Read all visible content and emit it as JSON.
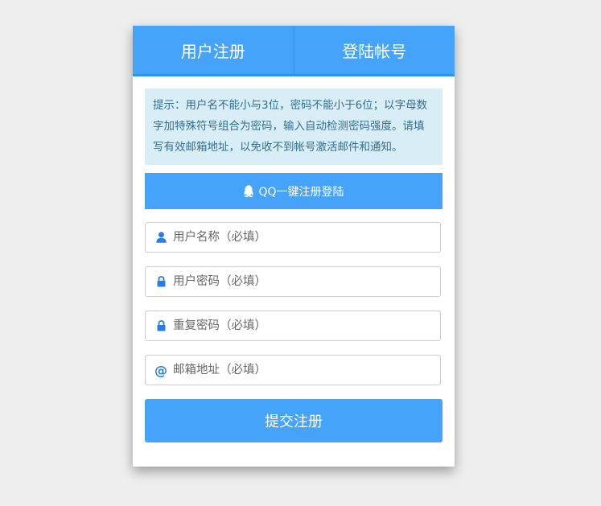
{
  "tabs": [
    {
      "label": "用户注册"
    },
    {
      "label": "登陆帐号"
    }
  ],
  "notice": {
    "text": "提示：用户名不能小与3位，密码不能小于6位；以字母数字加特殊符号组合为密码，输入自动检测密码强度。请填写有效邮箱地址，以免收不到帐号激活邮件和通知。"
  },
  "qq_button": {
    "label": "QQ一键注册登陆",
    "icon": "qq-icon"
  },
  "fields": [
    {
      "placeholder": "用户名称（必填）",
      "icon": "user-icon"
    },
    {
      "placeholder": "用户密码（必填）",
      "icon": "lock-icon"
    },
    {
      "placeholder": "重复密码（必填）",
      "icon": "lock-icon"
    },
    {
      "placeholder": "邮箱地址（必填）",
      "icon": "at-icon",
      "icon_glyph": "@"
    }
  ],
  "submit": {
    "label": "提交注册"
  },
  "colors": {
    "accent": "#45a4fa",
    "notice_bg": "#d9edf7",
    "notice_text": "#31708f",
    "icon": "#2a7de1",
    "page_bg": "#eeeeee"
  }
}
